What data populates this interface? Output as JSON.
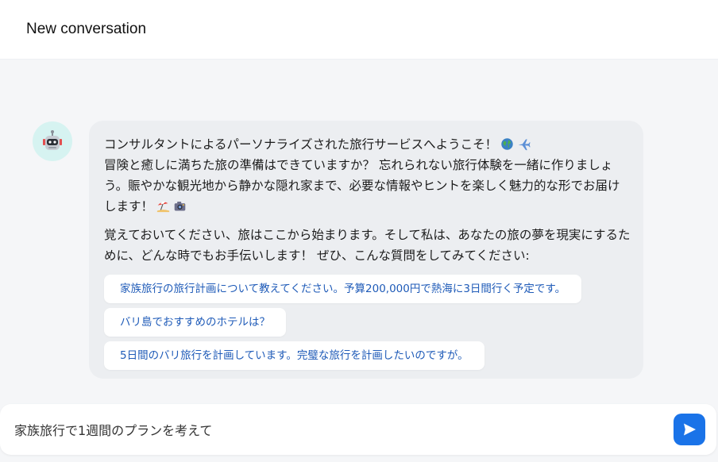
{
  "header": {
    "title": "New conversation"
  },
  "message": {
    "paragraph1": {
      "line1": "コンサルタントによるパーソナライズされた旅行サービスへようこそ！",
      "line1_icons": [
        "globe-icon",
        "airplane-icon"
      ],
      "line2": "冒険と癒しに満ちた旅の準備はできていますか？ 忘れられない旅行体験を一緒に作りましょう。賑やかな観光地から静かな隠れ家まで、必要な情報やヒントを楽しく魅力的な形でお届けします！",
      "line2_icons": [
        "beach-umbrella-icon",
        "camera-icon"
      ]
    },
    "paragraph2": "覚えておいてください、旅はここから始まります。そして私は、あなたの旅の夢を現実にするために、どんな時でもお手伝いします！ ぜひ、こんな質問をしてみてください:"
  },
  "suggestions": [
    "家族旅行の旅行計画について教えてください。予算200,000円で熱海に3日間行く予定です。",
    "バリ島でおすすめのホテルは？",
    "5日間のバリ旅行を計画しています。完璧な旅行を計画したいのですが。"
  ],
  "input": {
    "value": "家族旅行で1週間のプランを考えて"
  },
  "colors": {
    "accent": "#1a73e8",
    "suggestion_text": "#1f5bb8",
    "bubble_bg": "#eceef1",
    "avatar_bg": "#d6f3f1"
  }
}
